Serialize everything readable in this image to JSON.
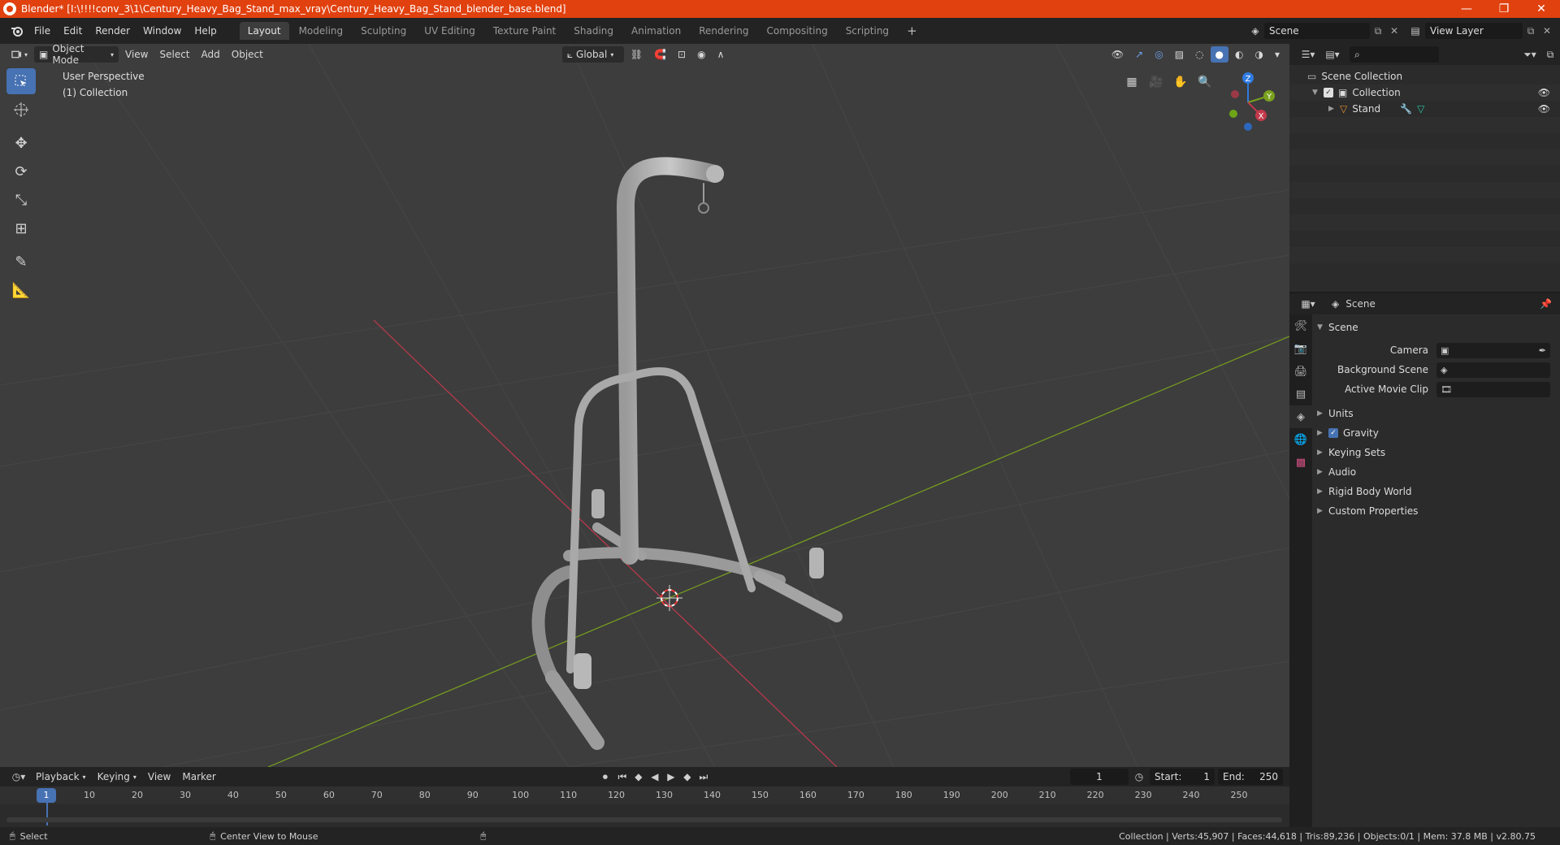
{
  "window": {
    "title": "Blender* [I:\\!!!!conv_3\\1\\Century_Heavy_Bag_Stand_max_vray\\Century_Heavy_Bag_Stand_blender_base.blend]",
    "minimize": "—",
    "maximize": "❐",
    "close": "✕"
  },
  "menu": [
    "File",
    "Edit",
    "Render",
    "Window",
    "Help"
  ],
  "workspaces": [
    "Layout",
    "Modeling",
    "Sculpting",
    "UV Editing",
    "Texture Paint",
    "Shading",
    "Animation",
    "Rendering",
    "Compositing",
    "Scripting"
  ],
  "workspace_add": "+",
  "scene_selector": "Scene",
  "view_layer_selector": "View Layer",
  "viewport": {
    "mode": "Object Mode",
    "menus": [
      "View",
      "Select",
      "Add",
      "Object"
    ],
    "orientation": "Global",
    "perspective_label": "User Perspective",
    "collection_label": "(1) Collection",
    "gizmo": {
      "z": "Z",
      "y": "Y",
      "x": "X"
    }
  },
  "outliner": {
    "rows": [
      {
        "label": "Scene Collection"
      },
      {
        "label": "Collection"
      },
      {
        "label": "Stand"
      }
    ]
  },
  "properties": {
    "context": "Scene",
    "panel_title": "Scene",
    "fields": [
      {
        "label": "Camera",
        "value": ""
      },
      {
        "label": "Background Scene",
        "value": ""
      },
      {
        "label": "Active Movie Clip",
        "value": ""
      }
    ],
    "subpanels": [
      "Units",
      "Gravity",
      "Keying Sets",
      "Audio",
      "Rigid Body World",
      "Custom Properties"
    ]
  },
  "timeline": {
    "menus": [
      "Playback",
      "Keying",
      "View",
      "Marker"
    ],
    "current_frame": "1",
    "start_label": "Start:",
    "start_value": "1",
    "end_label": "End:",
    "end_value": "250",
    "ticks": [
      "1",
      "10",
      "20",
      "30",
      "40",
      "50",
      "60",
      "70",
      "80",
      "90",
      "100",
      "110",
      "120",
      "130",
      "140",
      "150",
      "160",
      "170",
      "180",
      "190",
      "200",
      "210",
      "220",
      "230",
      "240",
      "250"
    ]
  },
  "statusbar": {
    "select": "Select",
    "center_view": "Center View to Mouse",
    "stats": "Collection | Verts:45,907 | Faces:44,618 | Tris:89,236 | Objects:0/1 | Mem: 37.8 MB | v2.80.75"
  },
  "colors": {
    "titlebar": "#e1410f",
    "viewport_bg": "#3d3d3d",
    "accent": "#4772b3",
    "x_axis": "#c2394b",
    "y_axis": "#7aa11d",
    "z_axis": "#2f7ae0"
  }
}
